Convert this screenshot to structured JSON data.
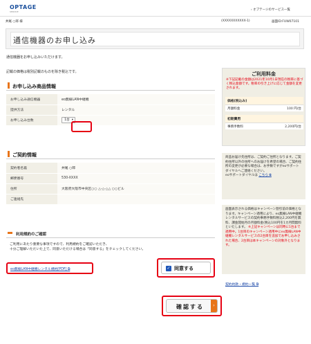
{
  "header": {
    "logo_main": "OPTAGE",
    "logo_sub": "SERVICE",
    "top_link": "› オプテージのサービス一覧"
  },
  "infobar": {
    "user": "井尾 ○郎 様",
    "code": "(XXXXXXXXXXX-1)",
    "screen_id": "画面ID:FUW07101"
  },
  "page": {
    "title": "通信機器のお申し込み",
    "lead": "通信機器をお申し込みいただけます。",
    "tax_note": "記載の価格は税別記載のものを除き税込です。"
  },
  "product_section": {
    "heading": "お申し込み商品情報",
    "rows": [
      {
        "label": "お申し込み通信機器",
        "value": "eo無線LAN中継機"
      },
      {
        "label": "提供方法",
        "value": "レンタル"
      },
      {
        "label": "お申し込み台数",
        "value": ""
      }
    ],
    "quantity": "1台"
  },
  "contract_section": {
    "heading": "ご契約情報",
    "rows": [
      {
        "label": "契約者名義",
        "value": "井尾 ○郎"
      },
      {
        "label": "郵便番号",
        "value": "530-XXXX"
      },
      {
        "label": "住所",
        "value": "大阪府大阪市中央区○○ △-△-△△ ○○ビル"
      },
      {
        "label": "ご連絡先",
        "value": ""
      }
    ]
  },
  "terms": {
    "heading": "利用規約のご確認",
    "body_1": "ご利用にあたり重要な事項ですので、利用規約をご確認いただき、",
    "body_2": "十分ご理解いただいた上で、同意いただける場合は「同意する」をチェックしてください。",
    "pdf_link": "eo無線LAN中継機レンタル規約[PDF] ⧉",
    "agree_label": "同意する"
  },
  "confirm_button": "確認する",
  "price_panel": {
    "title": "ご利用料金",
    "warning": "※下記記載の金額は2021年10月1日現在の税率に基づく税込金額です。税率の引き上げに応じて金額を変更されます。",
    "groups": [
      {
        "title": "価格(税込み)",
        "rows": [
          {
            "k": "月額料金",
            "v": "100 円/台"
          }
        ]
      },
      {
        "title": "初期費用",
        "rows": [
          {
            "k": "事務手数料",
            "v": "2,200円/台"
          }
        ]
      }
    ]
  },
  "side_panels": {
    "ship_text": "商品お届け先住所は、ご契約ご住所となります。ご契約住所以外の住所へのお届けを希望の場合、ご契約住所の変更が必要な場合は、お手数ですがeoサポートダイヤルへご連絡ください。",
    "ship_link_prefix": "eoサポートダイヤルは",
    "ship_link": "こちら ⧉",
    "campaign_text": "画面表示される価格はキャンペーン割引前の価格となります。キャンペーン適用により、eo無線LAN中継機レンタルサービスの契約事務手数料税込2,200円を無料、課金開始月の月額料金(税込100円を1カ月間無料といたします。",
    "campaign_red": "※上記キャンペーンは同時に1台まで適用中。1台目のキャンペーン適用中にeo無線LAN中継機レンタルサービスの2台目を追加でお申し込みされた場合、2台目は本キャンペーンの対象外となります。",
    "terms_list_link": "契約約款・規約一覧 ⧉"
  }
}
